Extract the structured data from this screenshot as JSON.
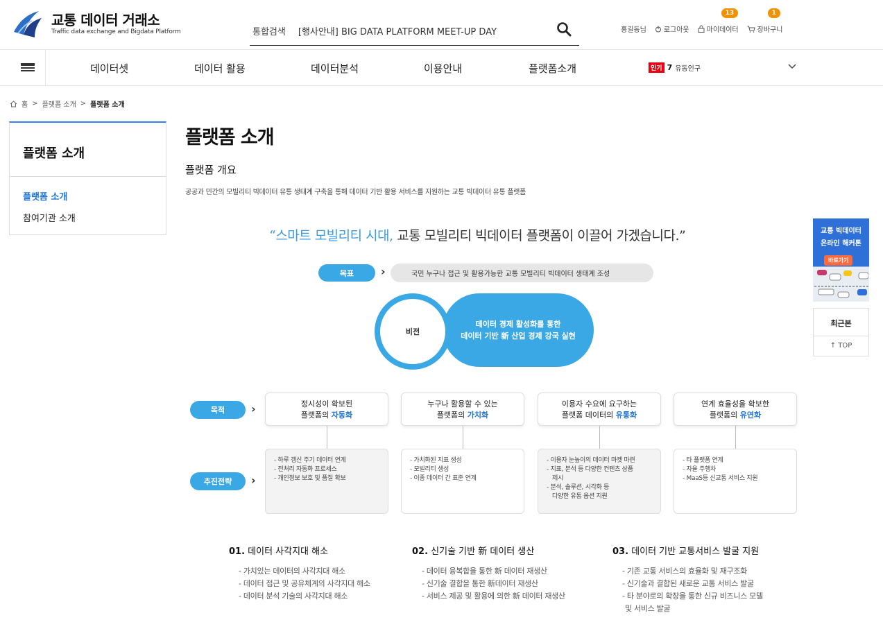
{
  "header": {
    "logo_title": "교통 데이터 거래소",
    "logo_sub": "Traffic data exchange and Bigdata Platform",
    "search_label": "통합검색",
    "search_value": "[행사안내] BIG DATA PLATFORM MEET-UP DAY",
    "user_name": "홍길동님",
    "logout": "로그아웃",
    "mydata": "마이데이터",
    "mydata_count": "13",
    "cart": "장바구니",
    "cart_count": "1"
  },
  "nav": {
    "items": [
      "데이터셋",
      "데이터 활용",
      "데이터분석",
      "이용안내",
      "플랫폼소개"
    ],
    "trend_badge": "인기",
    "trend_rank": "7",
    "trend_word": "유동인구"
  },
  "breadcrumb": {
    "home": "홈",
    "sep": ">",
    "level1": "플랫폼 소개",
    "current": "플랫폼 소개"
  },
  "sidebar": {
    "title": "플랫폼 소개",
    "items": [
      "플랫폼 소개",
      "참여기관 소개"
    ]
  },
  "main": {
    "page_title": "플랫폼 소개",
    "section_title": "플랫폼 개요",
    "section_desc": "공공과 민간의 모빌리티 빅데이터 유통 생태계 구축을 통해 데이터 기반 활용 서비스를 지원하는 교통 빅데이터 유통 플랫폼",
    "quote_open": "“",
    "quote_highlight": "스마트 모빌리티 시대,",
    "quote_rest": " 교통 모빌리티 빅데이터 플랫폼이 이끌어 가겠습니다.”",
    "goal_label": "목표",
    "goal_text": "국민 누구나 접근 및 활용가능한 교통 모빌리티 빅데이터 생태계 조성",
    "vision_label": "비전",
    "vision_line1": "데이터 경제 활성화를 통한",
    "vision_line2": "데이터 기반 新 산업 경제 강국 실현",
    "purpose_label": "목적",
    "strategy_label": "추진전략",
    "purposes": [
      {
        "line1": "정시성이 확보된",
        "pre": "플랫폼의 ",
        "kw": "자동화"
      },
      {
        "line1": "누구나 활용할 수 있는",
        "pre": "플랫폼의 ",
        "kw": "가치화"
      },
      {
        "line1": "이용자 수요에 요구하는",
        "pre": "플랫폼 데이터의 ",
        "kw": "유통화"
      },
      {
        "line1": "연계 효율성을 확보한",
        "pre": "플랫폼의 ",
        "kw": "유연화"
      }
    ],
    "strategies": [
      [
        "- 하루 갱신 주기 데이터 연계",
        "- 전처리 자동화 프로세스",
        "- 개인정보 보호 및 품질 확보"
      ],
      [
        "- 가치화된 지표 생성",
        "- 모빌리티 생성",
        "- 이종 데이터 간 표준 연계"
      ],
      [
        "- 이용자 눈높이의 데이터 마켓 마련",
        "- 지표, 분석 등 다양한 컨텐츠 상품",
        "  제시",
        "- 분석, 솔루션, 시각화 등",
        "  다양한 유통 옵션 지원"
      ],
      [
        "- 타 플랫폼 연계",
        "- 자율 주행차",
        "- MaaS등 신교통 서비스 지원"
      ]
    ],
    "columns": [
      {
        "num": "01.",
        "title": " 데이터 사각지대 해소",
        "items": [
          "- 가치있는 데이터의 사각지대 해소",
          "- 데이터 접근 및 공유체계의 사각지대 해소",
          "- 데이터 분석 기술의 사각지대 해소"
        ]
      },
      {
        "num": "02.",
        "title": " 신기술 기반 新 데이터 생산",
        "items": [
          "- 데이터 융복합을 통한 新 데이터 재생산",
          "- 신기술 결합을 통한 新데이터 재생산",
          "- 서비스 제공 및 활용에 의한 新 데이터 재생산"
        ]
      },
      {
        "num": "03.",
        "title": " 데이터 기반 교통서비스 발굴 지원",
        "items": [
          "- 기존 교통 서비스의 효율화 및 재구조화",
          "- 신기술과 결합된 새로운 교통 서비스 발굴",
          "- 타 분야로의 확장을 통한 신규 비즈니스 모델",
          "  및 서비스 발굴"
        ]
      }
    ]
  },
  "floating": {
    "hack_line1": "교통 빅데이터",
    "hack_line2": "온라인 해커톤",
    "hack_btn": "바로가기",
    "recent": "최근본",
    "top": "↑ TOP"
  },
  "colors": {
    "accent_blue": "#3ba8e6",
    "link_blue": "#1e74d6",
    "badge_orange": "#f29100",
    "hot_red": "#e60012"
  }
}
